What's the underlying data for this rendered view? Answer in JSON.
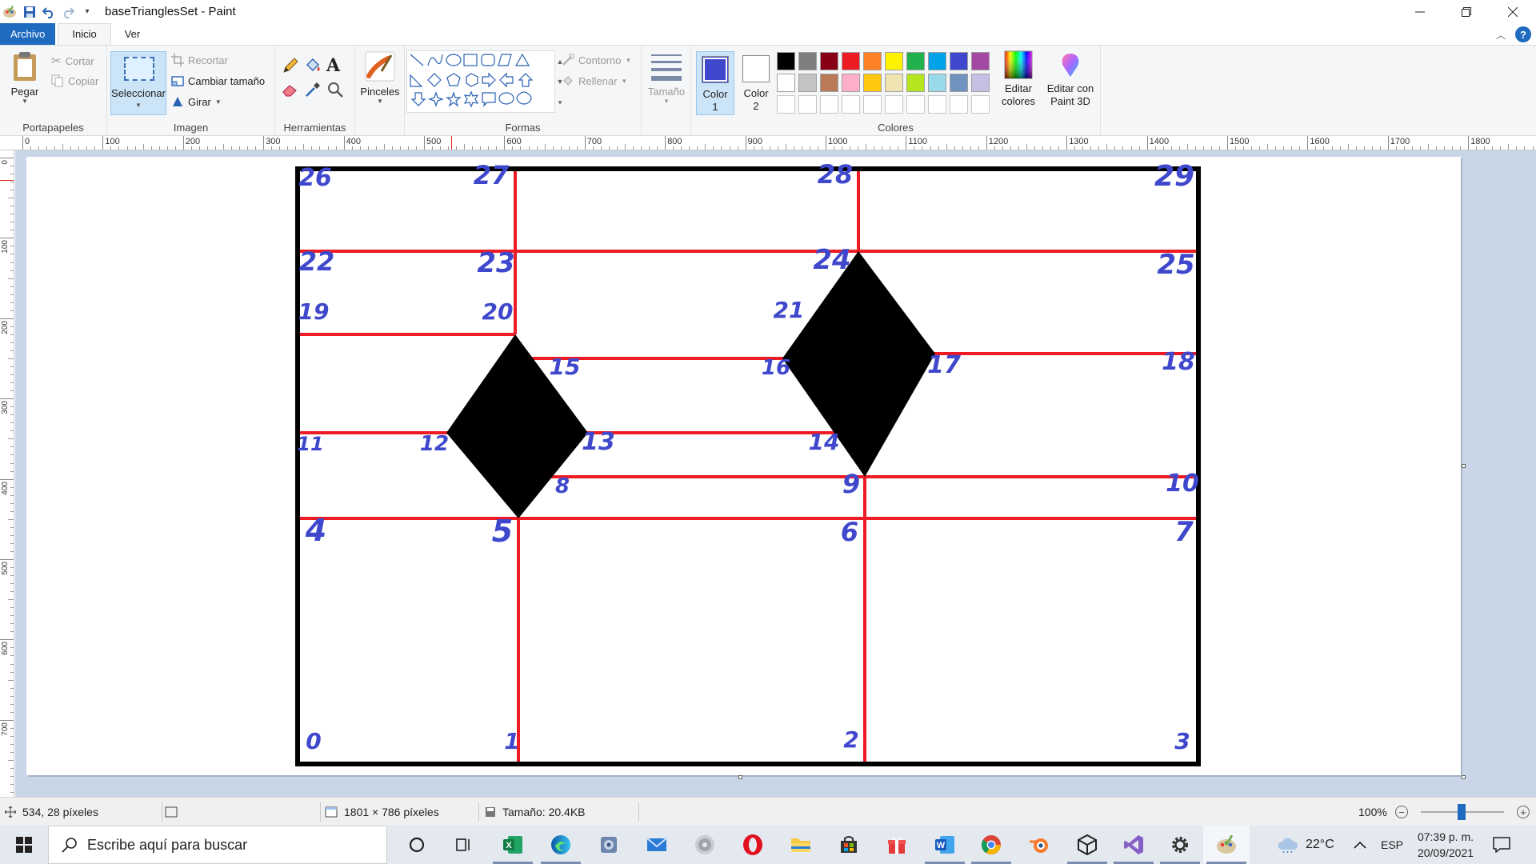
{
  "window": {
    "title": "baseTrianglesSet - Paint",
    "controls": [
      "minimize",
      "restore",
      "close"
    ]
  },
  "quick_access": [
    "save-icon",
    "undo-icon",
    "redo-icon",
    "customize-dropdown-icon"
  ],
  "tabs": {
    "file": "Archivo",
    "home": "Inicio",
    "view": "Ver"
  },
  "ribbon": {
    "clipboard": {
      "label": "Portapapeles",
      "paste": "Pegar",
      "cut": "Cortar",
      "copy": "Copiar"
    },
    "image": {
      "label": "Imagen",
      "select": "Seleccionar",
      "crop": "Recortar",
      "resize": "Cambiar tamaño",
      "rotate": "Girar"
    },
    "tools": {
      "label": "Herramientas",
      "items": [
        "pencil-icon",
        "fill-bucket-icon",
        "text-icon",
        "eraser-icon",
        "color-picker-icon",
        "magnifier-icon"
      ]
    },
    "brushes": {
      "label": "Pinceles"
    },
    "shapes": {
      "label": "Formas",
      "outline": "Contorno",
      "fill": "Rellenar"
    },
    "size": {
      "label": "Tamaño"
    },
    "colors": {
      "label": "Colores",
      "color1": {
        "label": "Color",
        "index": "1",
        "value": "#3f48cc"
      },
      "color2": {
        "label": "Color",
        "index": "2",
        "value": "#ffffff"
      },
      "edit": {
        "line1": "Editar",
        "line2": "colores"
      },
      "palette_row1": [
        "#000000",
        "#7f7f7f",
        "#880015",
        "#ed1c24",
        "#ff7f27",
        "#fff200",
        "#22b14c",
        "#00a2e8",
        "#3f48cc",
        "#a349a4"
      ],
      "palette_row2": [
        "#ffffff",
        "#c3c3c3",
        "#b97a57",
        "#ffaec9",
        "#ffc90e",
        "#efe4b0",
        "#b5e61d",
        "#99d9ea",
        "#7092be",
        "#c8bfe7"
      ]
    },
    "paint3d": {
      "line1": "Editar con",
      "line2": "Paint 3D"
    }
  },
  "ruler": {
    "horizontal_labels": [
      "0",
      "100",
      "200",
      "300",
      "400",
      "500",
      "600",
      "700",
      "800",
      "900",
      "1000",
      "1100",
      "1200",
      "1300",
      "1400",
      "1500",
      "1600",
      "1700",
      "1800"
    ],
    "vertical_labels": [
      "0",
      "100",
      "200",
      "300",
      "400",
      "500",
      "600",
      "700"
    ]
  },
  "canvas": {
    "region_labels": [
      "0",
      "1",
      "2",
      "3",
      "4",
      "5",
      "6",
      "7",
      "8",
      "9",
      "10",
      "11",
      "12",
      "13",
      "14",
      "15",
      "16",
      "17",
      "18",
      "19",
      "20",
      "21",
      "22",
      "23",
      "24",
      "25",
      "26",
      "27",
      "28",
      "29"
    ],
    "line_color": "#ed1c24",
    "label_color": "#3f48cc",
    "shape_color": "#000000"
  },
  "status": {
    "cursor": "534, 28 píxeles",
    "dimensions": "1801 × 786 píxeles",
    "size": "Tamaño: 20.4KB",
    "zoom": "100%"
  },
  "taskbar": {
    "search_placeholder": "Escribe aquí para buscar",
    "apps": [
      "cortana-icon",
      "task-view-icon",
      "excel-icon",
      "edge-icon",
      "app-icon",
      "mail-icon",
      "media-icon",
      "opera-icon",
      "file-explorer-icon",
      "store-icon",
      "gift-icon",
      "word-icon",
      "chrome-icon",
      "blender-icon",
      "unity-icon",
      "visual-studio-icon",
      "settings-icon",
      "paint-icon"
    ],
    "weather": "22°C",
    "language": "ESP",
    "time": "07:39 p. m.",
    "date": "20/09/2021"
  }
}
